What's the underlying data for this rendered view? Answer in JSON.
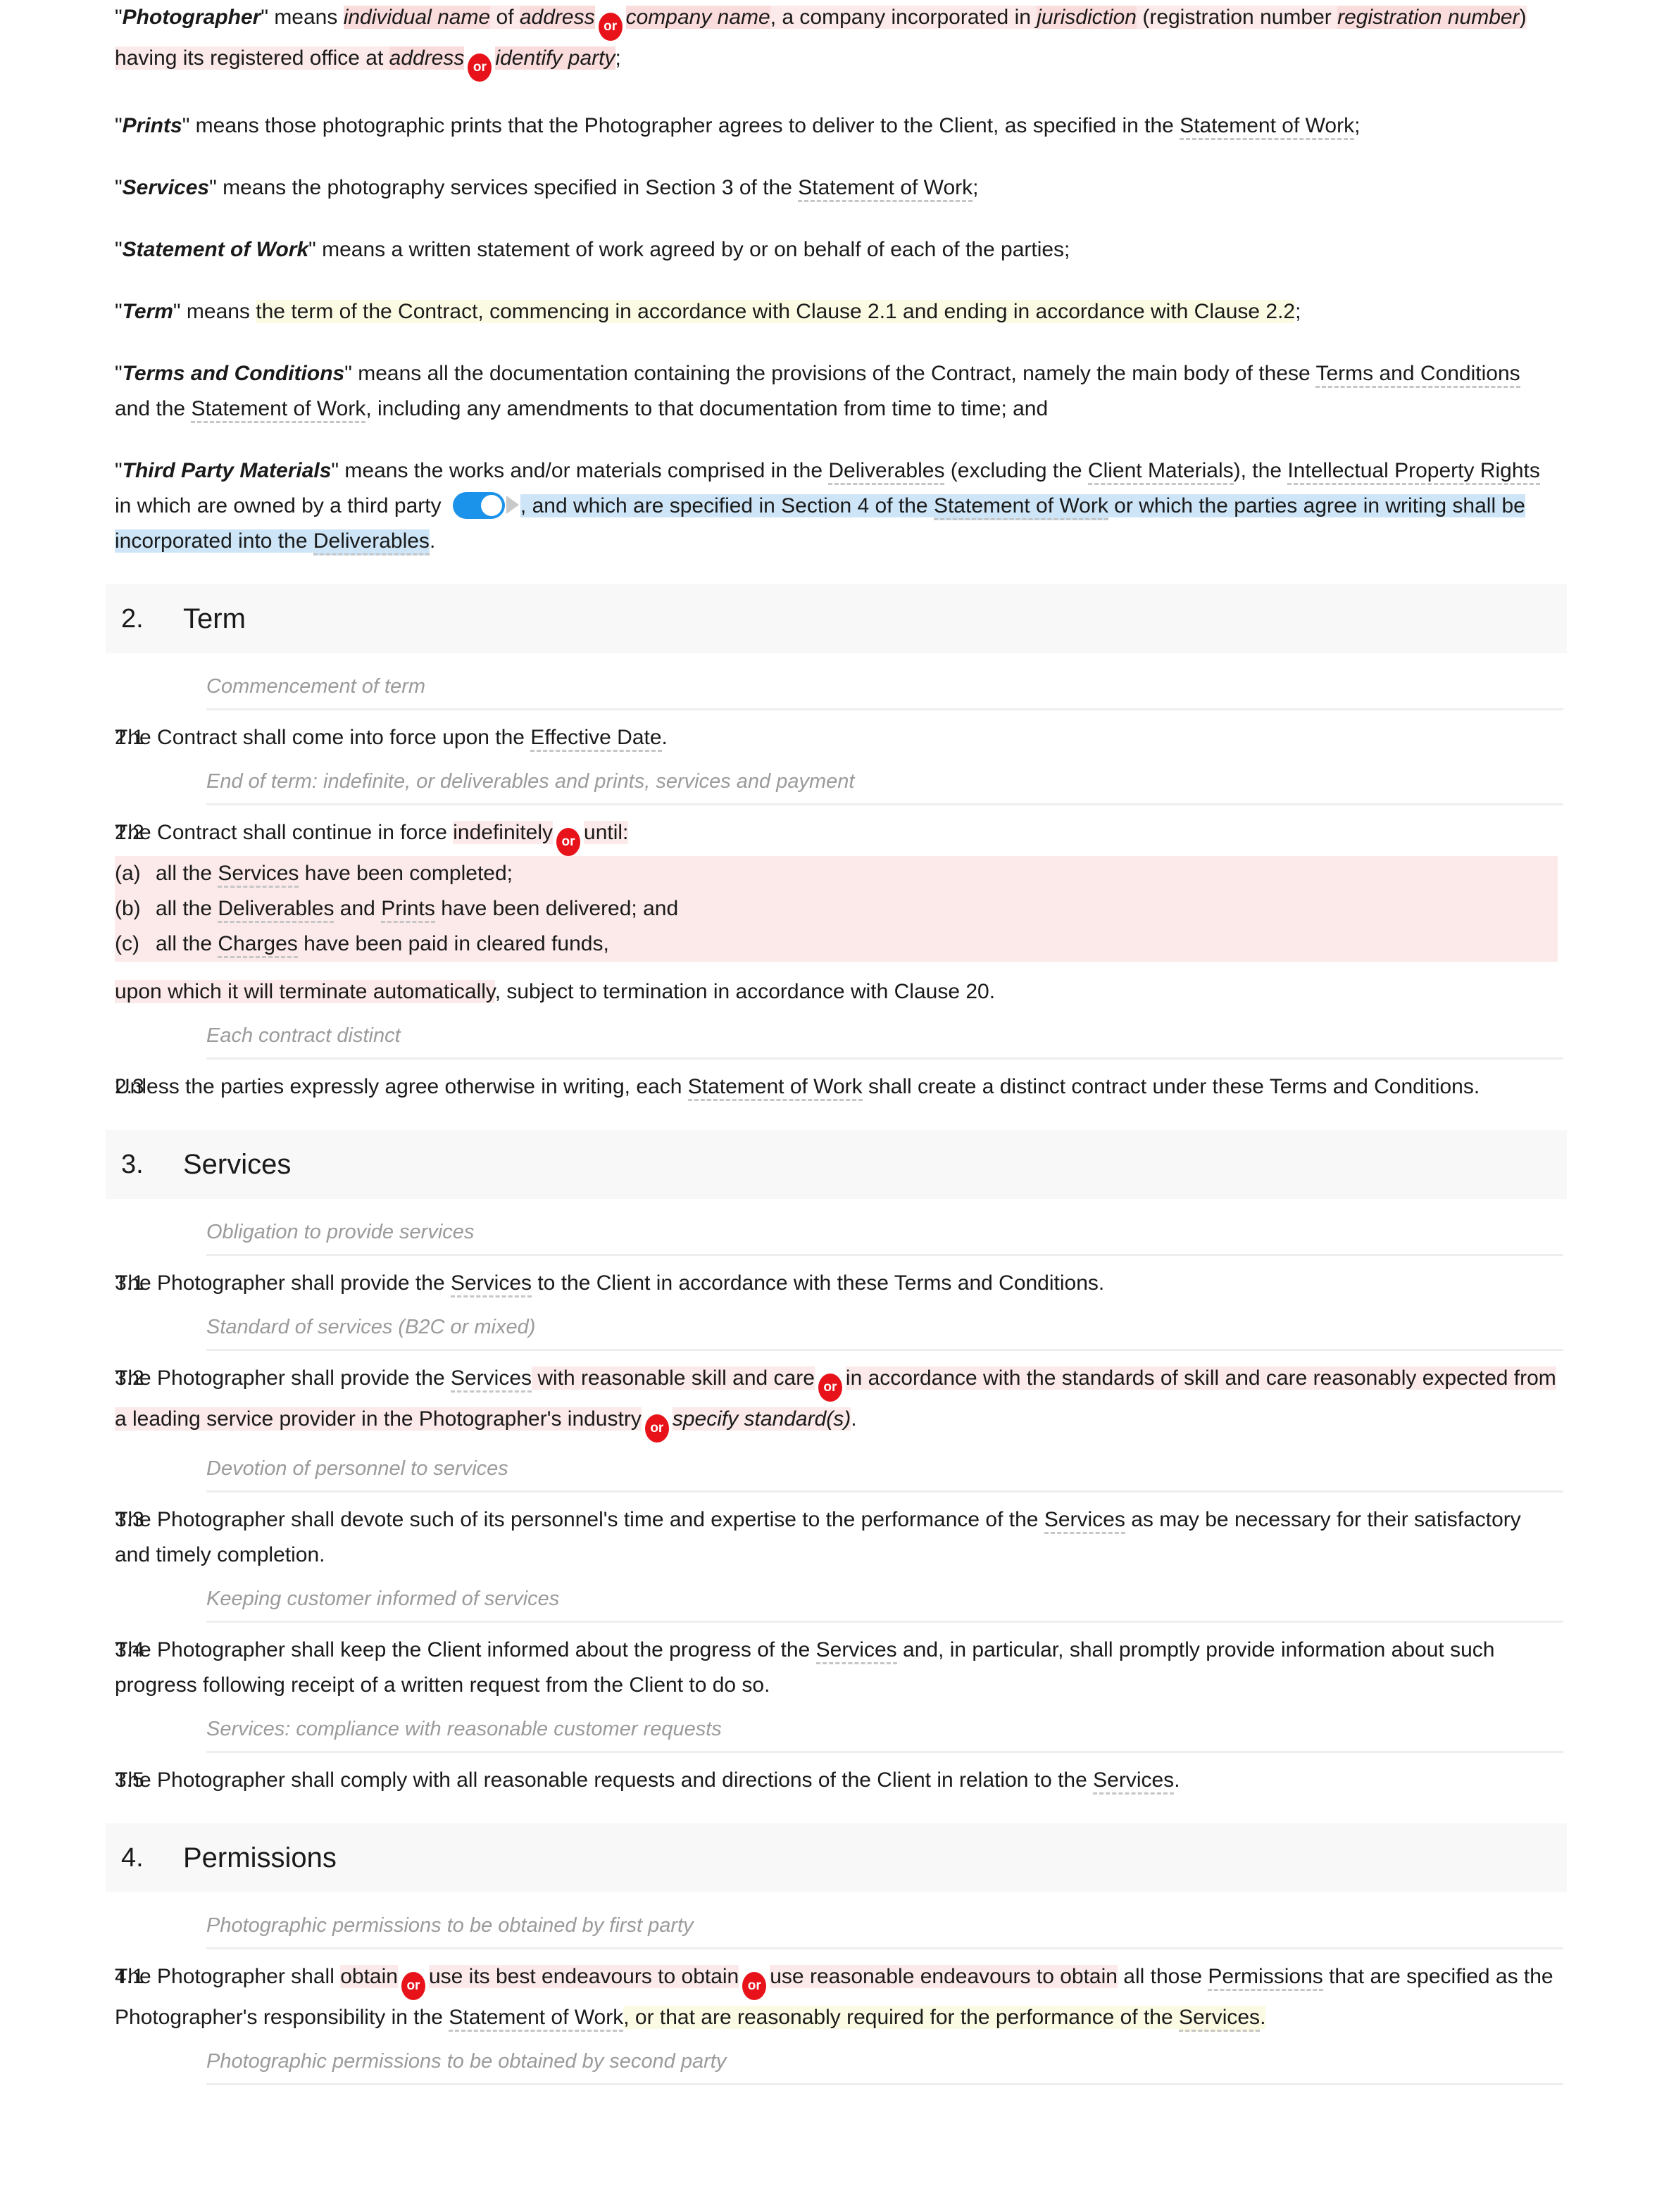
{
  "document": {
    "type": "contract-terms-and-conditions",
    "or_badge_label": "or",
    "colors": {
      "highlight_pink": "#fce9e9",
      "highlight_pink_strong": "#fbdcdc",
      "highlight_yellow": "#fbfbe4",
      "highlight_blue": "#cde5f7",
      "or_badge": "#e8131a",
      "toggle_on": "#1b93eb",
      "section_header_bg": "#f8f8f8",
      "subheading_text": "#9b9b9b",
      "rule": "#eeeeee"
    }
  },
  "definitions": [
    {
      "id": "photographer",
      "term": "Photographer",
      "segments": [
        {
          "text": "\"",
          "style": "plain"
        },
        {
          "text": "Photographer",
          "style": "defined-term-bold-italic"
        },
        {
          "text": "\" means ",
          "style": "plain"
        },
        {
          "text": "individual name",
          "style": "placeholder-pink-strong"
        },
        {
          "text": " of ",
          "style": "pink"
        },
        {
          "text": "address",
          "style": "placeholder-pink-strong"
        },
        {
          "text": "or",
          "style": "or-badge"
        },
        {
          "text": "company name",
          "style": "placeholder-pink-strong"
        },
        {
          "text": ", a company incorporated in ",
          "style": "pink"
        },
        {
          "text": "jurisdiction",
          "style": "placeholder-pink-strong"
        },
        {
          "text": " (registration number ",
          "style": "pink"
        },
        {
          "text": "registration number",
          "style": "placeholder-pink-strong"
        },
        {
          "text": ") having its registered office at ",
          "style": "pink"
        },
        {
          "text": "address",
          "style": "placeholder-pink-strong"
        },
        {
          "text": "or",
          "style": "or-badge"
        },
        {
          "text": "identify party",
          "style": "placeholder-pink-strong"
        },
        {
          "text": ";",
          "style": "plain"
        }
      ]
    },
    {
      "id": "prints",
      "term": "Prints",
      "text_before": "\" means those photographic prints that the Photographer agrees to deliver to the Client, as specified in the ",
      "linked_term": "Statement of Work",
      "text_after": ";"
    },
    {
      "id": "services",
      "term": "Services",
      "text_before": "\" means the photography services specified in Section 3 of the ",
      "linked_term": "Statement of Work",
      "text_after": ";"
    },
    {
      "id": "statement-of-work",
      "term": "Statement of Work",
      "text_before": "\" means a written statement of work agreed by or on behalf of each of the parties;",
      "linked_term": "",
      "text_after": ""
    },
    {
      "id": "term",
      "term": "Term",
      "text_before": "\" means ",
      "highlighted": "the term of the Contract, commencing in accordance with Clause 2.1 and ending in accordance with Clause 2.2",
      "text_after": ";"
    },
    {
      "id": "terms-and-conditions",
      "term": "Terms and Conditions",
      "text_before": "\" means all the documentation containing the provisions of the Contract, namely the main body of these ",
      "linked_term_1": "Terms and Conditions",
      "mid": " and the ",
      "linked_term_2": "Statement of Work",
      "text_after": ", including any amendments to that documentation from time to time; and"
    },
    {
      "id": "third-party-materials",
      "term": "Third Party Materials",
      "part1": "\" means the works and/or materials comprised in the ",
      "link1": "Deliverables",
      "part2": " (excluding the ",
      "link2": "Client Materials",
      "part3": "), the ",
      "link3": "Intellectual Property Rights",
      "part4": " in which are owned by a third party ",
      "toggle_state": "on",
      "part5": ", and which are specified in Section 4 of the ",
      "link4": "Statement of Work",
      "part6": " or which the parties agree in writing shall be incorporated into the ",
      "link5": "Deliverables",
      "part7": "."
    }
  ],
  "sections": [
    {
      "number": "2.",
      "title": "Term",
      "clauses": [
        {
          "subheading": "Commencement of term",
          "number": "2.1",
          "text_before": "The Contract shall come into force upon the ",
          "linked_term": "Effective Date",
          "text_after": "."
        },
        {
          "subheading": "End of term: indefinite, or deliverables and prints, services and payment",
          "number": "2.2",
          "lead_plain": "The Contract shall continue in force ",
          "lead_option_a": "indefinitely",
          "lead_option_b": "until:",
          "list": [
            {
              "label": "(a)",
              "text_before": "all the ",
              "linked_term": "Services",
              "text_after": " have been completed;"
            },
            {
              "label": "(b)",
              "text_before": "all the ",
              "linked_term": "Deliverables",
              "mid": " and ",
              "linked_term_2": "Prints",
              "text_after": " have been delivered; and"
            },
            {
              "label": "(c)",
              "text_before": "all the ",
              "linked_term": "Charges",
              "text_after": " have been paid in cleared funds,"
            }
          ],
          "tail_highlighted": "upon which it will terminate automatically",
          "tail_plain": ", subject to termination in accordance with Clause 20."
        },
        {
          "subheading": "Each contract distinct",
          "number": "2.3",
          "text_before": "Unless the parties expressly agree otherwise in writing, each ",
          "linked_term": "Statement of Work",
          "text_after": " shall create a distinct contract under these Terms and Conditions."
        }
      ]
    },
    {
      "number": "3.",
      "title": "Services",
      "clauses": [
        {
          "subheading": "Obligation to provide services",
          "number": "3.1",
          "text_before": "The Photographer shall provide the ",
          "linked_term": "Services",
          "text_after": " to the Client in accordance with these Terms and Conditions."
        },
        {
          "subheading": "Standard of services (B2C or mixed)",
          "number": "3.2",
          "text_before": "The Photographer shall provide the ",
          "linked_term": "Services",
          "option_a": "with reasonable skill and care",
          "option_b": "in accordance with the standards of skill and care reasonably expected from a leading service provider in the Photographer's industry",
          "option_c": "specify standard(s)",
          "text_after": "."
        },
        {
          "subheading": "Devotion of personnel to services",
          "number": "3.3",
          "text_before": "The Photographer shall devote such of its personnel's time and expertise to the performance of the ",
          "linked_term": "Services",
          "text_after": " as may be necessary for their satisfactory and timely completion."
        },
        {
          "subheading": "Keeping customer informed of services",
          "number": "3.4",
          "text_before": "The Photographer shall keep the Client informed about the progress of the ",
          "linked_term": "Services",
          "text_after": " and, in particular, shall promptly provide information about such progress following receipt of a written request from the Client to do so."
        },
        {
          "subheading": "Services: compliance with reasonable customer requests",
          "number": "3.5",
          "text_before": "The Photographer shall comply with all reasonable requests and directions of the Client in relation to the ",
          "linked_term": "Services",
          "text_after": "."
        }
      ]
    },
    {
      "number": "4.",
      "title": "Permissions",
      "clauses": [
        {
          "subheading": "Photographic permissions to be obtained by first party",
          "number": "4.1",
          "lead": "The Photographer shall ",
          "option_a": "obtain",
          "option_b": "use its best endeavours to obtain",
          "option_c": "use reasonable endeavours to obtain",
          "mid_plain": " all those ",
          "link_permissions": "Permissions",
          "mid_plain_2": " that are specified as the Photographer's responsibility in the ",
          "link_sow": "Statement of Work",
          "yellow_tail_1": ", or that are reasonably required for the performance of the ",
          "link_services": "Services",
          "yellow_tail_2": "."
        },
        {
          "subheading": "Photographic permissions to be obtained by second party",
          "number": "",
          "text_before": "",
          "linked_term": "",
          "text_after": ""
        }
      ]
    }
  ]
}
